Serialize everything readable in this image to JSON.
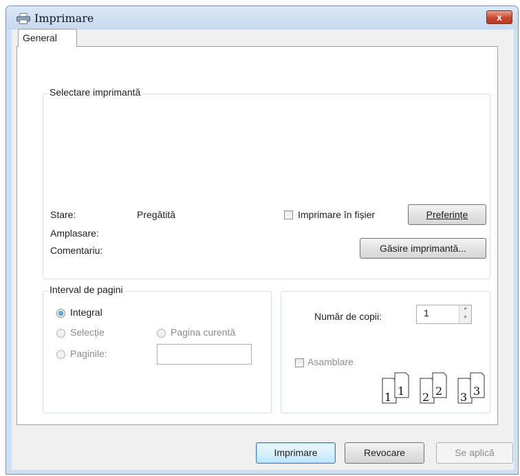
{
  "window": {
    "title": "Imprimare",
    "close_glyph": "x",
    "icon": "printer-icon"
  },
  "tabs": [
    {
      "label": "General",
      "selected": true
    }
  ],
  "printer_group": {
    "label": "Selectare imprimantă",
    "status_label": "Stare:",
    "status_value": "Pregătită",
    "location_label": "Amplasare:",
    "comment_label": "Comentariu:",
    "print_to_file_label": "Imprimare în fișier",
    "print_to_file_checked": false,
    "preferences_button": "Preferințe",
    "find_printer_button": "Găsire imprimantă..."
  },
  "range_group": {
    "label": "Interval de pagini",
    "options": [
      {
        "label": "Integral",
        "checked": true,
        "enabled": true
      },
      {
        "label": "Selecție",
        "checked": false,
        "enabled": false
      },
      {
        "label": "Pagina curentă",
        "checked": false,
        "enabled": false
      },
      {
        "label": "Paginile:",
        "checked": false,
        "enabled": false
      }
    ],
    "pages_value": ""
  },
  "copies_group": {
    "copies_label": "Număr de copii:",
    "copies_value": "1",
    "collate_label": "Asamblare",
    "collate_checked": false,
    "collate_pages": [
      "1",
      "1",
      "2",
      "2",
      "3",
      "3"
    ]
  },
  "buttons": {
    "print": "Imprimare",
    "cancel": "Revocare",
    "apply": "Se aplică"
  },
  "colors": {
    "title_bar": "#cfe0f1",
    "close_button": "#c8472f",
    "primary_border": "#3c7fb1",
    "group_border": "#d5dfe5"
  }
}
